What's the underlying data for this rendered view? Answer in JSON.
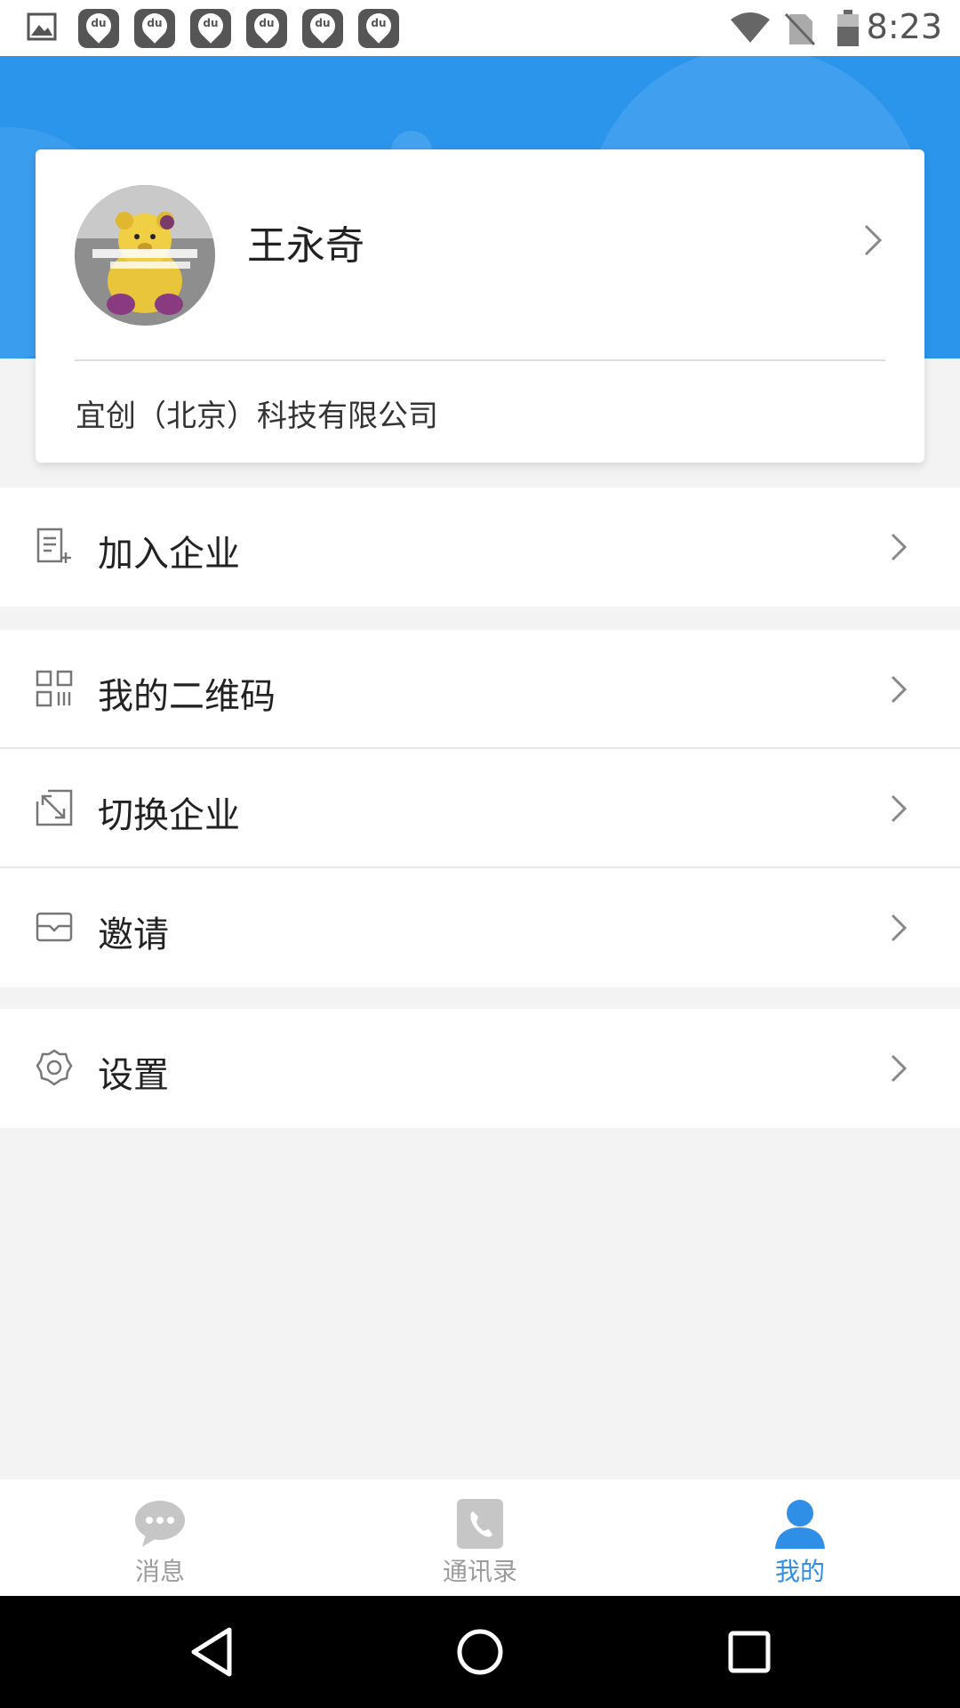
{
  "status_bar": {
    "time": "8:23",
    "notification_icons": [
      "image-icon",
      "du-icon",
      "du-icon",
      "du-icon",
      "du-icon",
      "du-icon",
      "du-icon"
    ],
    "du_text": "du",
    "system_icons": [
      "wifi-icon",
      "no-sim-icon",
      "battery-icon"
    ]
  },
  "profile": {
    "name": "王永奇",
    "company": "宜创（北京）科技有限公司"
  },
  "menu": {
    "join_enterprise": "加入企业",
    "my_qrcode": "我的二维码",
    "switch_enterprise": "切换企业",
    "invite": "邀请",
    "settings": "设置"
  },
  "tabs": {
    "messages": "消息",
    "contacts": "通讯录",
    "mine": "我的"
  },
  "colors": {
    "header_blue": "#2b95ec",
    "active_tab": "#2f8ee6",
    "inactive_tab": "#c6c6c6"
  }
}
